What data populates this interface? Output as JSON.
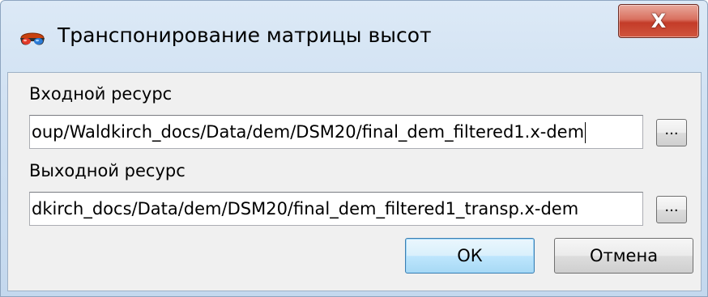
{
  "window": {
    "title": "Транспонирование матрицы высот",
    "icon": "stereo-glasses-icon",
    "close_label": "X"
  },
  "input": {
    "label": "Входной ресурс",
    "value": "oup/Waldkirch_docs/Data/dem/DSM20/final_dem_filtered1.x-dem",
    "browse_label": "..."
  },
  "output": {
    "label": "Выходной ресурс",
    "value": "dkirch_docs/Data/dem/DSM20/final_dem_filtered1_transp.x-dem",
    "browse_label": "..."
  },
  "buttons": {
    "ok_label": "ОК",
    "cancel_label": "Отмена"
  },
  "colors": {
    "title_bar": "#cfe0f2",
    "close_button": "#c43b28",
    "default_button": "#bee6fd",
    "client_background": "#f0f0f0"
  }
}
